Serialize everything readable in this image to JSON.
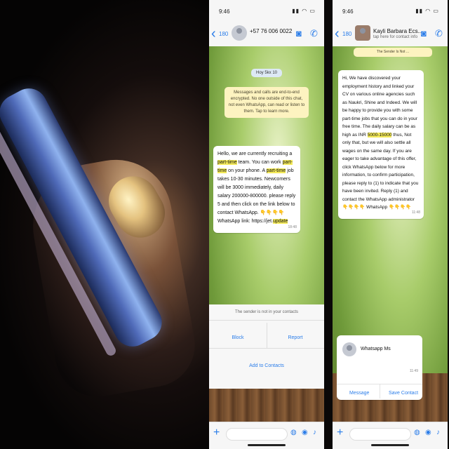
{
  "left_screen": {
    "status_time": "9:46",
    "back_count": "180",
    "contact_name": "+57 76 006 0022",
    "date_pill": "Hoy 5kx 10",
    "notice": "Messages and calls are end-to-end encrypted. No one outside of this chat, not even WhatsApp, can read or listen to them. Tap to learn more.",
    "message_parts": [
      {
        "text": "Hello, we are currently recruiting a ",
        "hl": false
      },
      {
        "text": "part-time",
        "hl": true
      },
      {
        "text": " team. You can work ",
        "hl": false
      },
      {
        "text": "part-time",
        "hl": true
      },
      {
        "text": " on your phone. A ",
        "hl": false
      },
      {
        "text": "part-time",
        "hl": true
      },
      {
        "text": " job takes 10-30 minutes. Newcomers will be 3000 immediately, daily salary 200000-800000. please reply 5 and then click on the link below to contact WhatsApp. ",
        "hl": false
      },
      {
        "text": "👇👇👇👇",
        "hl": false
      },
      {
        "text": " WhatsApp link: https://jet.",
        "hl": false
      },
      {
        "text": "update",
        "hl": true
      }
    ],
    "message_time": "18:48",
    "sheet_title": "The sender is not in your contacts",
    "sheet_left": "Block",
    "sheet_right": "Report",
    "sheet_bottom": "Add to Contacts"
  },
  "right_screen": {
    "status_time": "9:46",
    "back_count": "180",
    "contact_name": "Kayli Barbara Ecs...",
    "contact_sub": "tap here for contact info",
    "notice": "The Sender Is Not ...",
    "message_parts": [
      {
        "text": "Hi, We have discovered your employment history and linked your CV on various online agencies such as Naukri, Shine and Indeed. We will be happy to provide you with some part-time jobs that you can do in your free time. The daily salary can be as high as INR ",
        "hl": false
      },
      {
        "text": "5000-15000",
        "hl": true
      },
      {
        "text": " thus, Not only that, but we will also settle all wages on the same day. If you are eager to take advantage of this offer, click WhatsApp below for more information, to confirm participation, please reply to (1) to indicate that you have been invited. Reply (1) and contact the WhatsApp administrator ",
        "hl": false
      },
      {
        "text": "👇👇👇👇 WhatsApp 👇👇👇👇",
        "hl": false
      }
    ],
    "message_time": "11:48",
    "card_name": "Whatsapp Ms",
    "card_time": "11:49",
    "card_left": "Message",
    "card_right": "Save Contact"
  },
  "colors": {
    "accent": "#2b7de9",
    "highlight": "#f4ea5a",
    "notice": "#fdf3c0"
  },
  "icons": [
    "back-icon",
    "video-call-icon",
    "phone-icon",
    "plus-icon",
    "camera-icon",
    "mic-icon",
    "sticker-icon"
  ]
}
